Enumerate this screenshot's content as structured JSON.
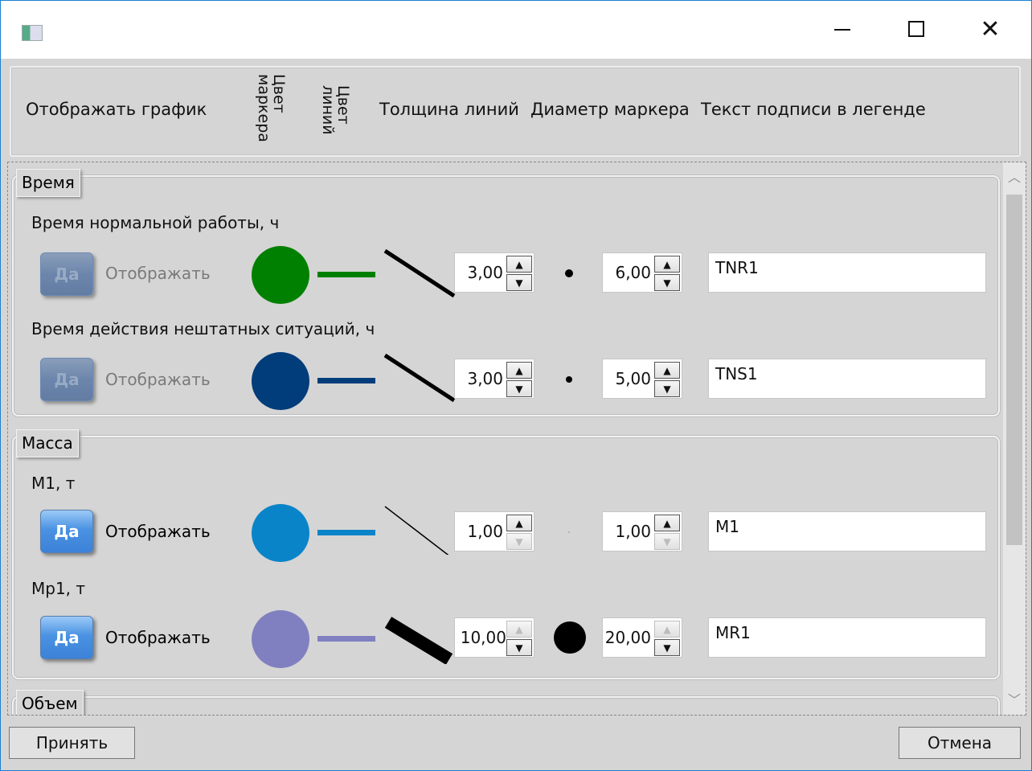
{
  "window": {
    "title": ""
  },
  "header": {
    "show_chart": "Отображать график",
    "marker_color": "Цвет маркера",
    "line_color": "Цвет линий",
    "line_thickness": "Толщина линий",
    "marker_diameter": "Диаметр маркера",
    "legend_text": "Текст подписи в легенде"
  },
  "groups": [
    {
      "title": "Время",
      "rows": [
        {
          "label": "Время нормальной работы, ч",
          "toggle": "Да",
          "toggle_on": false,
          "show_text": "Отображать",
          "color": "#008000",
          "thickness": "3,00",
          "diameter": "6,00",
          "legend": "TNR1"
        },
        {
          "label": "Время действия нештатных ситуаций, ч",
          "toggle": "Да",
          "toggle_on": false,
          "show_text": "Отображать",
          "color": "#003d7a",
          "thickness": "3,00",
          "diameter": "5,00",
          "legend": "TNS1"
        }
      ]
    },
    {
      "title": "Масса",
      "rows": [
        {
          "label": "М1, т",
          "toggle": "Да",
          "toggle_on": true,
          "show_text": "Отображать",
          "color": "#0a84c8",
          "thickness": "1,00",
          "diameter": "1,00",
          "legend": "M1"
        },
        {
          "label": "Мр1, т",
          "toggle": "Да",
          "toggle_on": true,
          "show_text": "Отображать",
          "color": "#8080c0",
          "thickness": "10,00",
          "diameter": "20,00",
          "legend": "MR1"
        }
      ]
    },
    {
      "title": "Объем",
      "rows": []
    }
  ],
  "footer": {
    "accept": "Принять",
    "cancel": "Отмена"
  }
}
